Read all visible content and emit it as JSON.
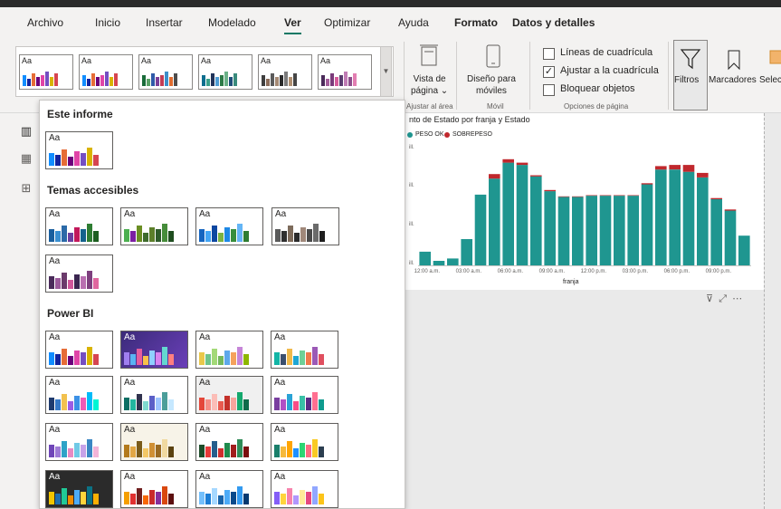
{
  "menu": {
    "tabs": [
      {
        "label": "Archivo"
      },
      {
        "label": "Inicio"
      },
      {
        "label": "Insertar"
      },
      {
        "label": "Modelado"
      },
      {
        "label": "Ver"
      },
      {
        "label": "Optimizar"
      },
      {
        "label": "Ayuda"
      },
      {
        "label": "Formato"
      },
      {
        "label": "Datos y detalles"
      }
    ],
    "active": "Ver"
  },
  "ribbon": {
    "vista_pagina": "Vista de página",
    "vista_pagina_line1": "Vista de",
    "vista_pagina_line2": "página",
    "diseno_moviles_line1": "Diseño para",
    "diseno_moviles_line2": "móviles",
    "group_ajustar": "Ajustar al área",
    "group_movil": "Móvil",
    "group_opciones": "Opciones de página",
    "lineas": "Líneas de cuadrícula",
    "ajustar": "Ajustar a la cuadrícula",
    "bloquear": "Bloquear objetos",
    "filtros": "Filtros",
    "marcadores": "Marcadores",
    "selec": "Selec"
  },
  "theme_panel": {
    "sections": [
      {
        "title": "Este informe"
      },
      {
        "title": "Temas accesibles"
      },
      {
        "title": "Power BI"
      }
    ],
    "thumb_label": "Aa"
  },
  "colors": {
    "accent": "#117865",
    "peso_ok": "#1f9690",
    "sobrepeso": "#c0282d"
  },
  "visual": {
    "title": "nto de Estado por franja y Estado",
    "xlabel": "franja",
    "y_tick_suffix": "ill."
  },
  "chart_data": {
    "type": "bar",
    "stacked": true,
    "title": "nto de Estado por franja y Estado",
    "xlabel": "franja",
    "ylabel": "",
    "legend": "top-left",
    "series": [
      {
        "name": "PESO OK",
        "color": "#1f9690",
        "values": [
          1.2,
          0.4,
          0.6,
          2.3,
          6.2,
          7.6,
          9.0,
          8.8,
          7.8,
          6.5,
          6.0,
          6.0,
          6.1,
          6.1,
          6.1,
          6.1,
          7.1,
          8.4,
          8.4,
          8.2,
          7.7,
          5.8,
          4.8,
          2.6
        ]
      },
      {
        "name": "SOBREPESO",
        "color": "#c0282d",
        "values": [
          0,
          0,
          0,
          0,
          0,
          0.4,
          0.3,
          0.2,
          0.1,
          0.1,
          0.05,
          0.05,
          0.05,
          0.05,
          0.05,
          0.05,
          0.1,
          0.3,
          0.4,
          0.6,
          0.4,
          0.1,
          0.1,
          0
        ]
      }
    ],
    "x_ticks": [
      "12:00 a.m.",
      "03:00 a.m.",
      "06:00 a.m.",
      "09:00 a.m.",
      "12:00 p.m.",
      "03:00 p.m.",
      "06:00 p.m.",
      "09:00 p.m."
    ],
    "ylim": [
      0,
      10
    ]
  }
}
